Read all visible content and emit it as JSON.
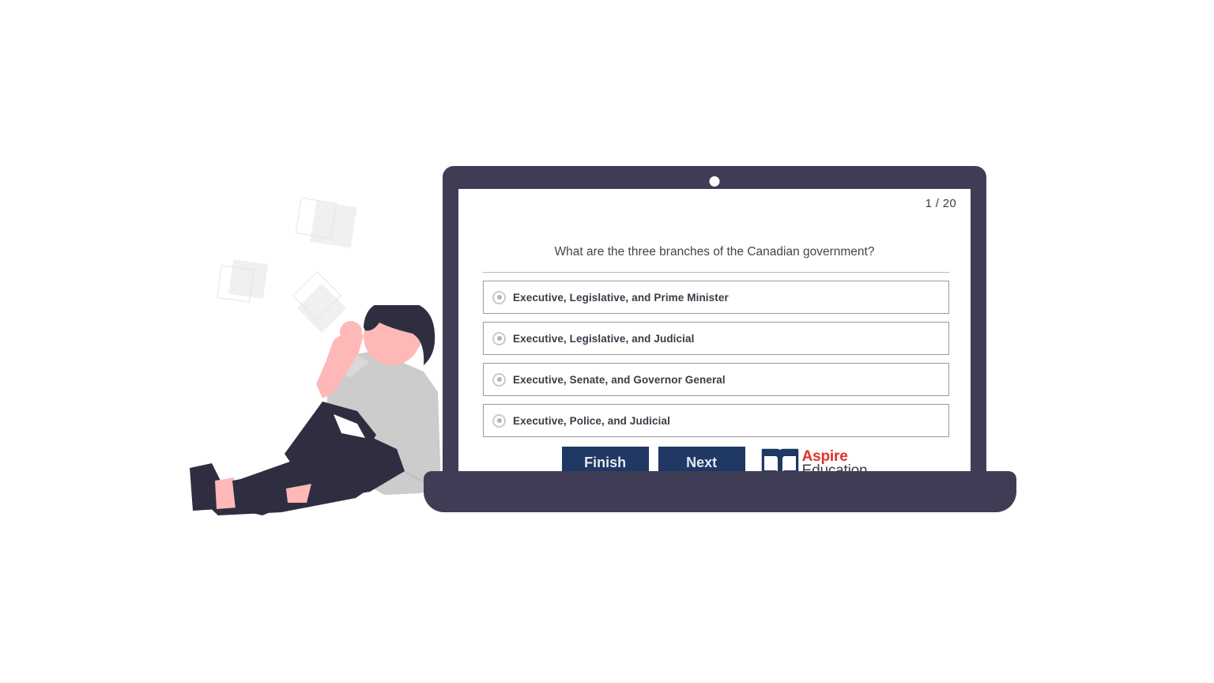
{
  "theme": {
    "laptop_frame": "#3f3d56",
    "button_navy": "#1f3864",
    "logo_red": "#e03127",
    "logo_dark": "#3b3b47",
    "option_border": "#9a9aa2",
    "skin": "#ffb8b8",
    "hair_and_pants": "#2f2e41",
    "shirt_grey": "#cccccc",
    "square_outline": "#e4e4e4",
    "square_fill": "#efefef"
  },
  "quiz": {
    "counter": "1 / 20",
    "question": "What are the three branches of the Canadian government?",
    "options": [
      {
        "label": "Executive, Legislative, and Prime Minister",
        "selected": false
      },
      {
        "label": "Executive, Legislative, and Judicial",
        "selected": false
      },
      {
        "label": "Executive, Senate, and Governor General",
        "selected": false
      },
      {
        "label": "Executive, Police, and Judicial",
        "selected": false
      }
    ],
    "buttons": {
      "finish": "Finish",
      "next": "Next"
    }
  },
  "logo": {
    "icon": "open-book-icon",
    "line1": "Aspire",
    "line2": "Education"
  },
  "illustration": {
    "subject": "person-sitting-leaning-on-laptop",
    "decorations": "floating-squares"
  }
}
